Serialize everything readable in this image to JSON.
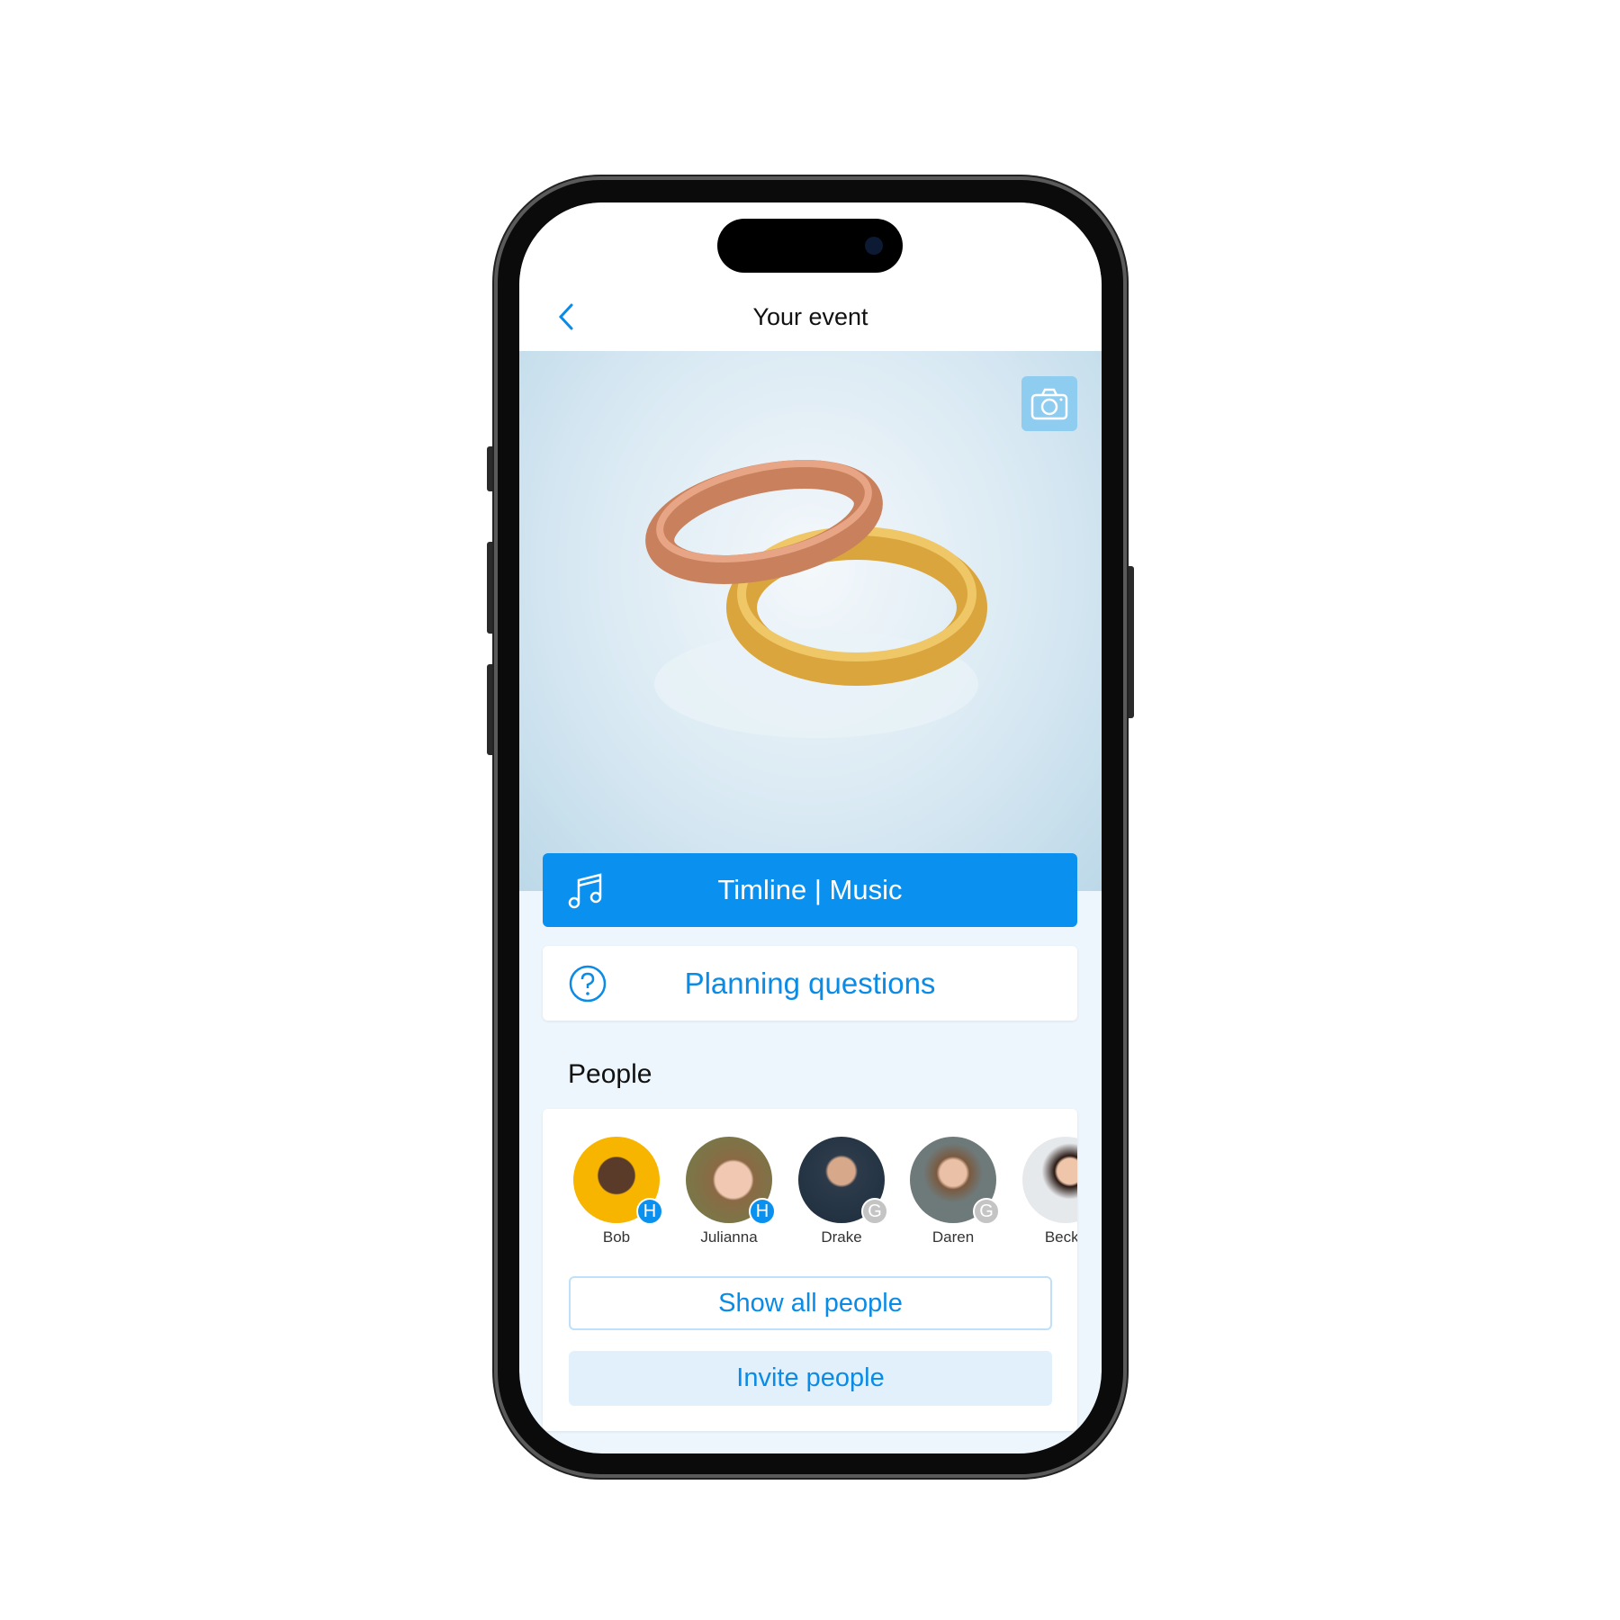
{
  "header": {
    "title": "Your event",
    "back_icon": "chevron-left-icon"
  },
  "hero": {
    "camera_icon": "camera-icon"
  },
  "actions": {
    "timeline_label": "Timline | Music",
    "timeline_icon": "music-note-icon",
    "planning_label": "Planning questions",
    "planning_icon": "question-circle-icon"
  },
  "people": {
    "section_label": "People",
    "list": [
      {
        "name": "Bob",
        "role_badge": "H",
        "badge_color": "#0a91ef"
      },
      {
        "name": "Julianna",
        "role_badge": "H",
        "badge_color": "#0a91ef"
      },
      {
        "name": "Drake",
        "role_badge": "G",
        "badge_color": "#c4c4c4"
      },
      {
        "name": "Daren",
        "role_badge": "G",
        "badge_color": "#c4c4c4"
      },
      {
        "name": "Becky",
        "role_badge": "",
        "badge_color": ""
      }
    ],
    "show_all_label": "Show all people",
    "invite_label": "Invite people"
  },
  "colors": {
    "accent": "#0a91ef",
    "background": "#eef6fd"
  }
}
